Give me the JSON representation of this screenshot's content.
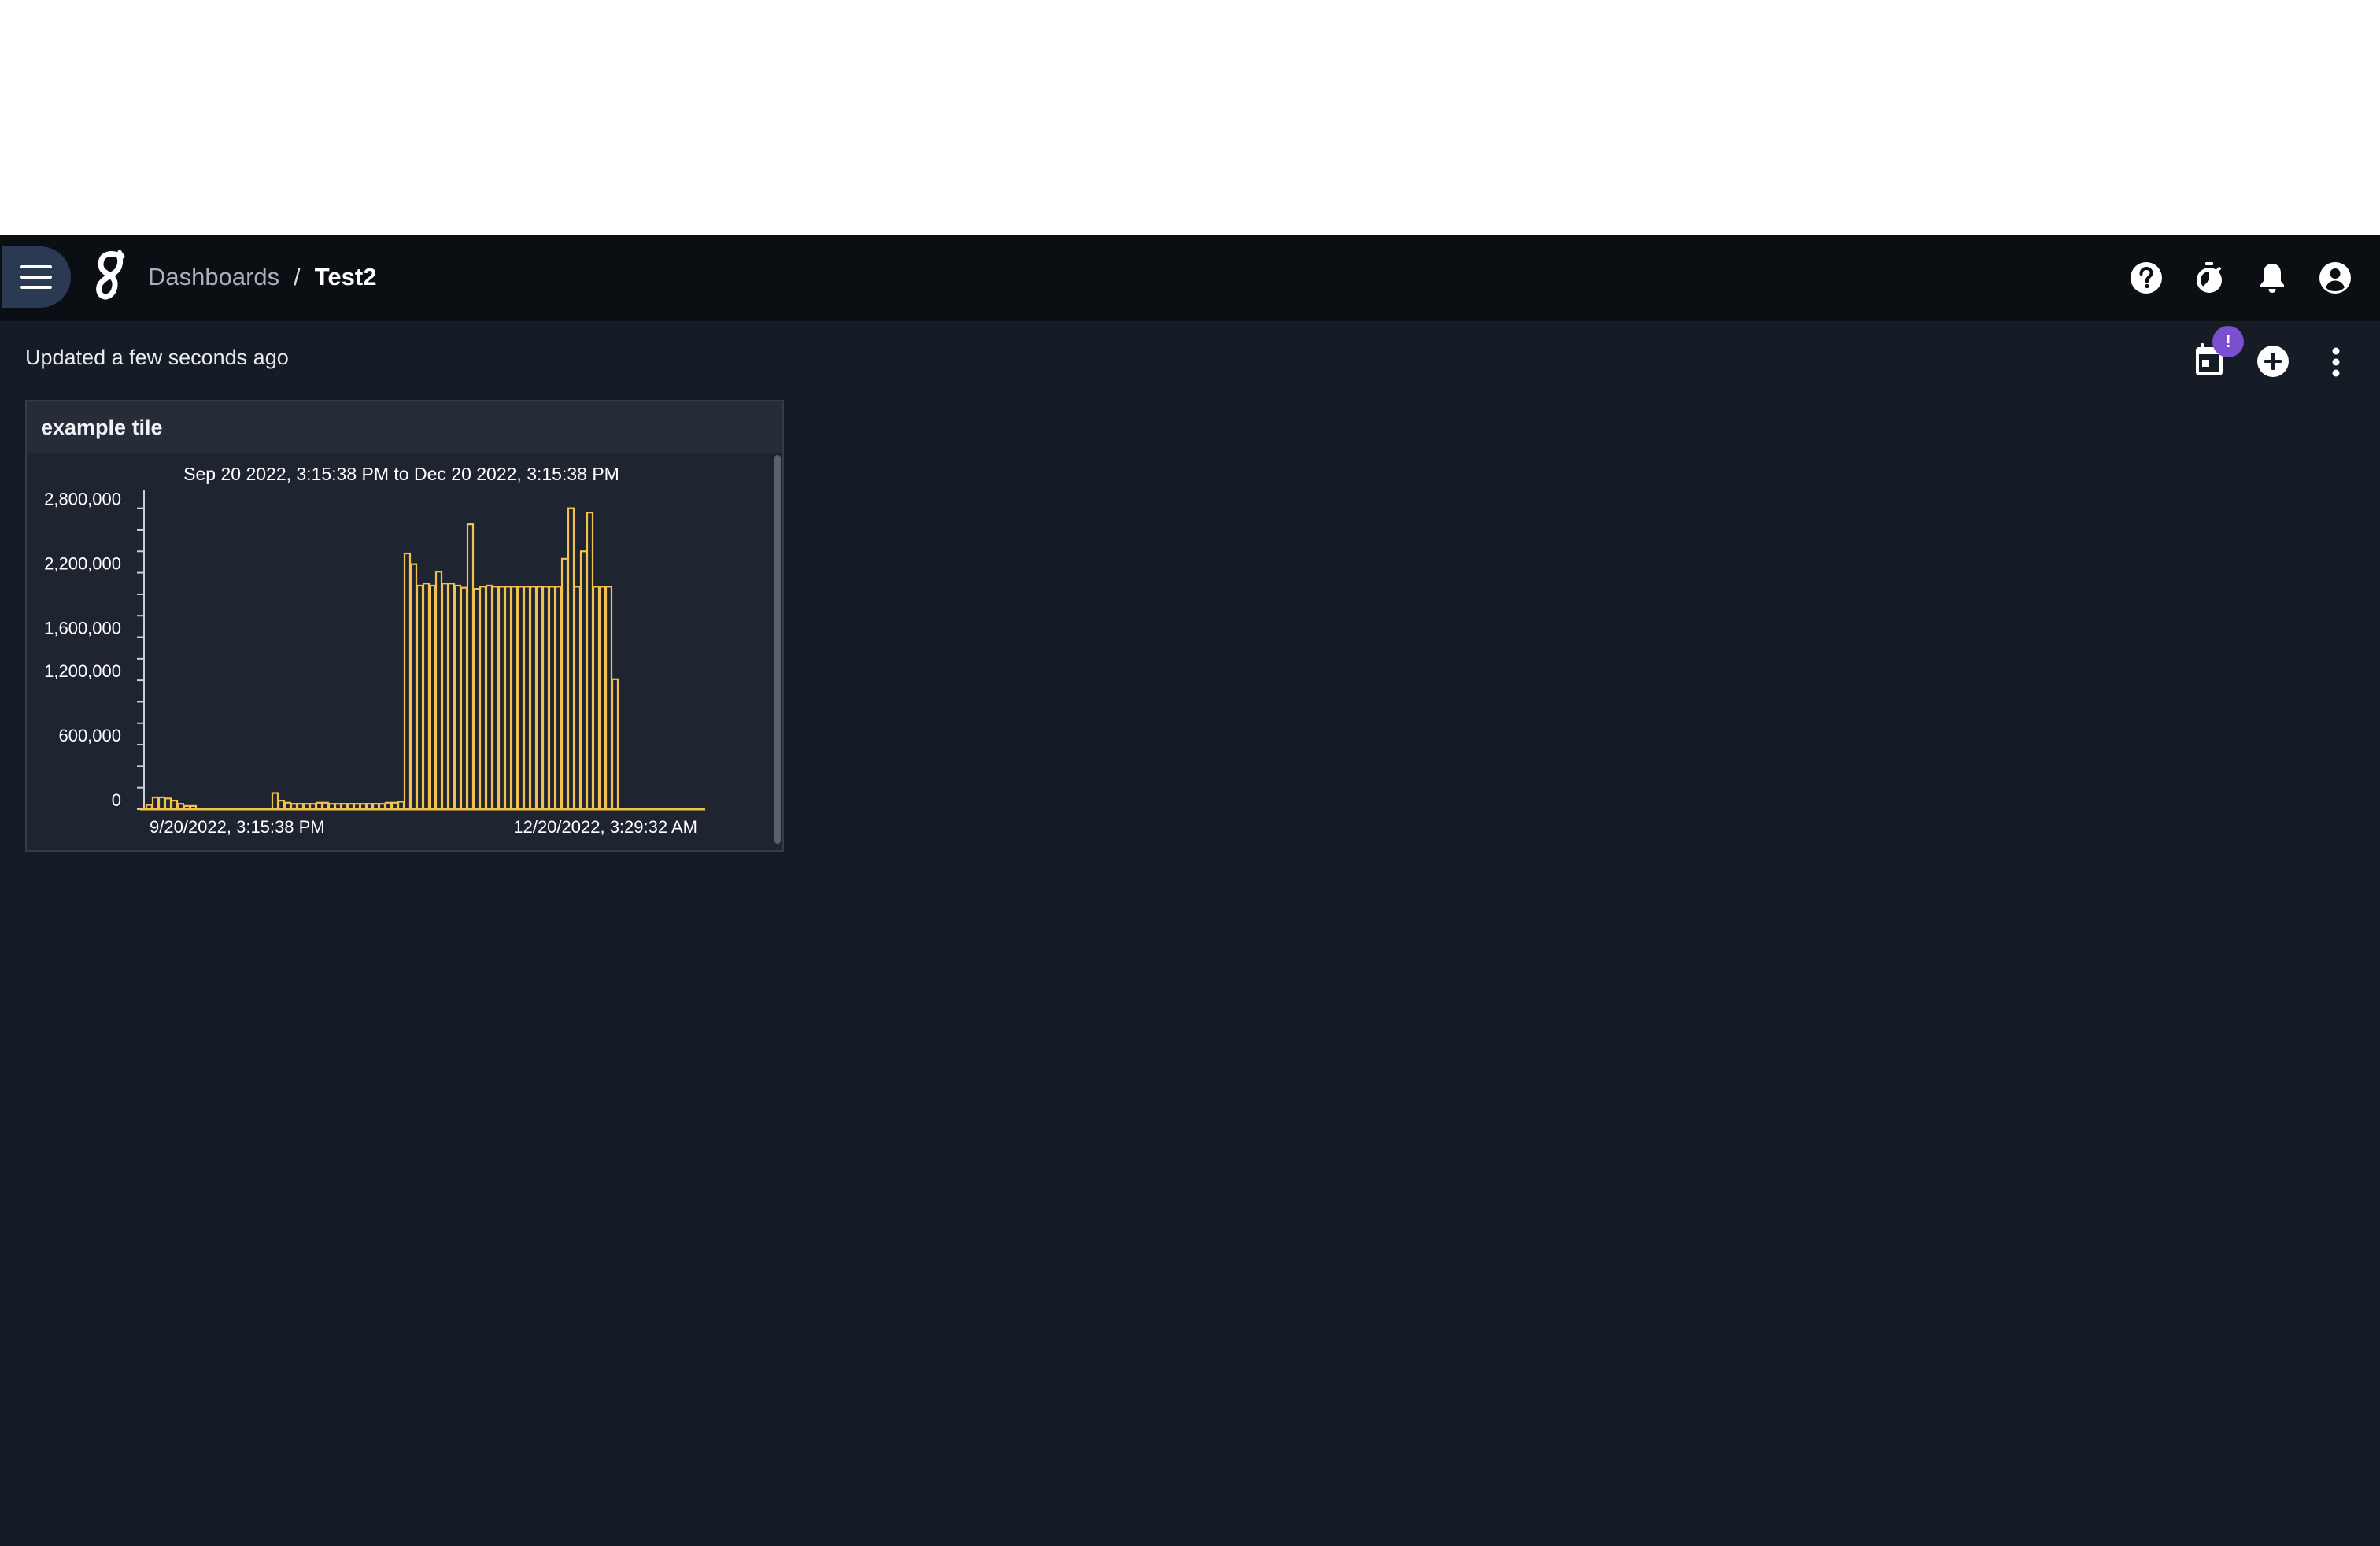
{
  "navbar": {
    "breadcrumb": {
      "parent": "Dashboards",
      "separator": "/",
      "current": "Test2"
    }
  },
  "toolbar": {
    "updated_text": "Updated a few seconds ago",
    "schedule_badge": "!"
  },
  "icons": {
    "menu": "hamburger-icon",
    "logo": "app-logo",
    "help": "question-circle-icon",
    "timer": "stopwatch-icon",
    "notifications": "bell-icon",
    "account": "account-circle-icon",
    "schedule": "calendar-icon",
    "add": "plus-circle-icon",
    "more": "more-vertical-icon"
  },
  "colors": {
    "background": "#161c26",
    "navbar": "#0b0e13",
    "tile": "#1f2530",
    "bar_fill": "#f2c14e",
    "bar_stroke": "#e0a52a",
    "badge": "#7c4fd0"
  },
  "tile": {
    "title": "example tile"
  },
  "chart_data": {
    "type": "bar",
    "title": "Sep 20 2022, 3:15:38 PM to Dec 20 2022, 3:15:38 PM",
    "xlabel": "",
    "ylabel": "",
    "x_tick_labels": [
      "9/20/2022, 3:15:38 PM",
      "12/20/2022, 3:29:32 AM"
    ],
    "y_tick_labels": [
      "2,800,000",
      "2,200,000",
      "1,600,000",
      "1,200,000",
      "600,000",
      "0"
    ],
    "y_ticks": [
      2800000,
      2200000,
      1600000,
      1200000,
      600000,
      0
    ],
    "ylim": [
      0,
      2900000
    ],
    "grid": false,
    "values": [
      40000,
      110000,
      110000,
      100000,
      80000,
      50000,
      30000,
      30000,
      0,
      0,
      0,
      0,
      0,
      0,
      0,
      0,
      0,
      0,
      0,
      0,
      150000,
      80000,
      60000,
      50000,
      50000,
      50000,
      50000,
      60000,
      60000,
      50000,
      50000,
      50000,
      50000,
      50000,
      50000,
      50000,
      50000,
      50000,
      60000,
      60000,
      70000,
      2380000,
      2280000,
      2080000,
      2100000,
      2080000,
      2210000,
      2100000,
      2100000,
      2080000,
      2060000,
      2650000,
      2050000,
      2070000,
      2080000,
      2070000,
      2070000,
      2070000,
      2070000,
      2070000,
      2070000,
      2070000,
      2070000,
      2070000,
      2070000,
      2070000,
      2330000,
      2800000,
      2070000,
      2400000,
      2760000,
      2070000,
      2070000,
      2070000,
      1210000,
      0,
      0,
      0,
      0,
      0,
      0,
      0,
      0,
      0,
      0,
      0,
      0,
      0
    ]
  }
}
